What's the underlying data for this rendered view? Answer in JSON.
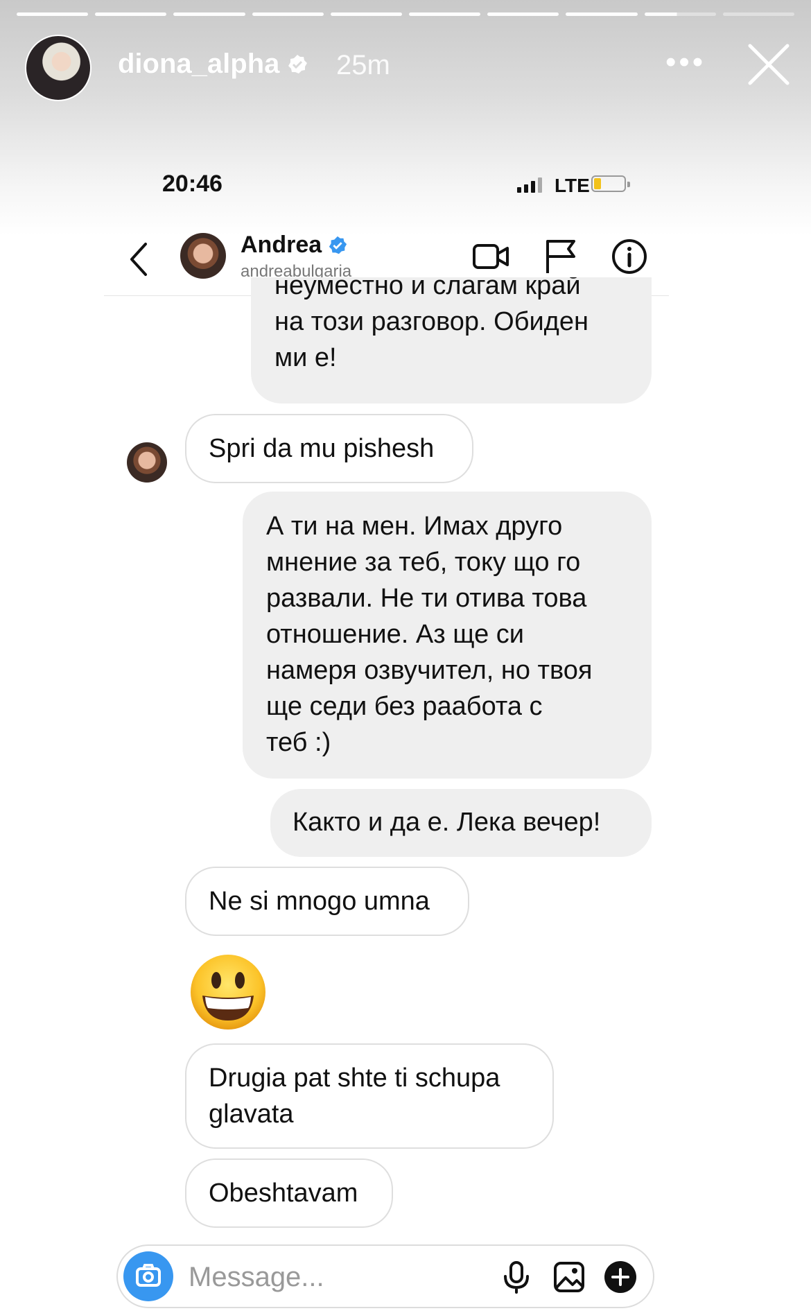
{
  "story": {
    "username": "diona_alpha",
    "time_ago": "25m"
  },
  "status_bar": {
    "time": "20:46",
    "network": "LTE"
  },
  "chat": {
    "name": "Andrea",
    "handle": "andreabulgaria"
  },
  "messages": [
    {
      "from": "me",
      "text": "неуместно и слагам край\nна този разговор. Обиден\nми е!"
    },
    {
      "from": "them",
      "text": "Spri da mu pishesh"
    },
    {
      "from": "me",
      "text": "А ти на мен. Имах друго\nмнение за теб, току що го\nразвали. Не ти отива това\nотношение. Аз ще си\nнамеря озвучител, но твоя\nще седи без раабота с\nтеб :)"
    },
    {
      "from": "me",
      "text": "Както и да е. Лека вечер!"
    },
    {
      "from": "them",
      "text": "Ne si mnogo umna"
    },
    {
      "from": "them",
      "text": "😀",
      "type": "emoji",
      "icon": "grinning-face-emoji"
    },
    {
      "from": "them",
      "text": "Drugia pat shte ti schupa\nglavata"
    },
    {
      "from": "them",
      "text": "Obeshtavam"
    }
  ],
  "composer": {
    "placeholder": "Message..."
  },
  "colors": {
    "accent": "#3897f0",
    "sent_bubble": "#efefef",
    "battery_low": "#f2c21b"
  },
  "icons": [
    "verified-badge-icon",
    "more-options-icon",
    "close-icon",
    "back-chevron-icon",
    "video-call-icon",
    "flag-icon",
    "info-icon",
    "camera-icon",
    "microphone-icon",
    "gallery-icon",
    "plus-icon"
  ]
}
